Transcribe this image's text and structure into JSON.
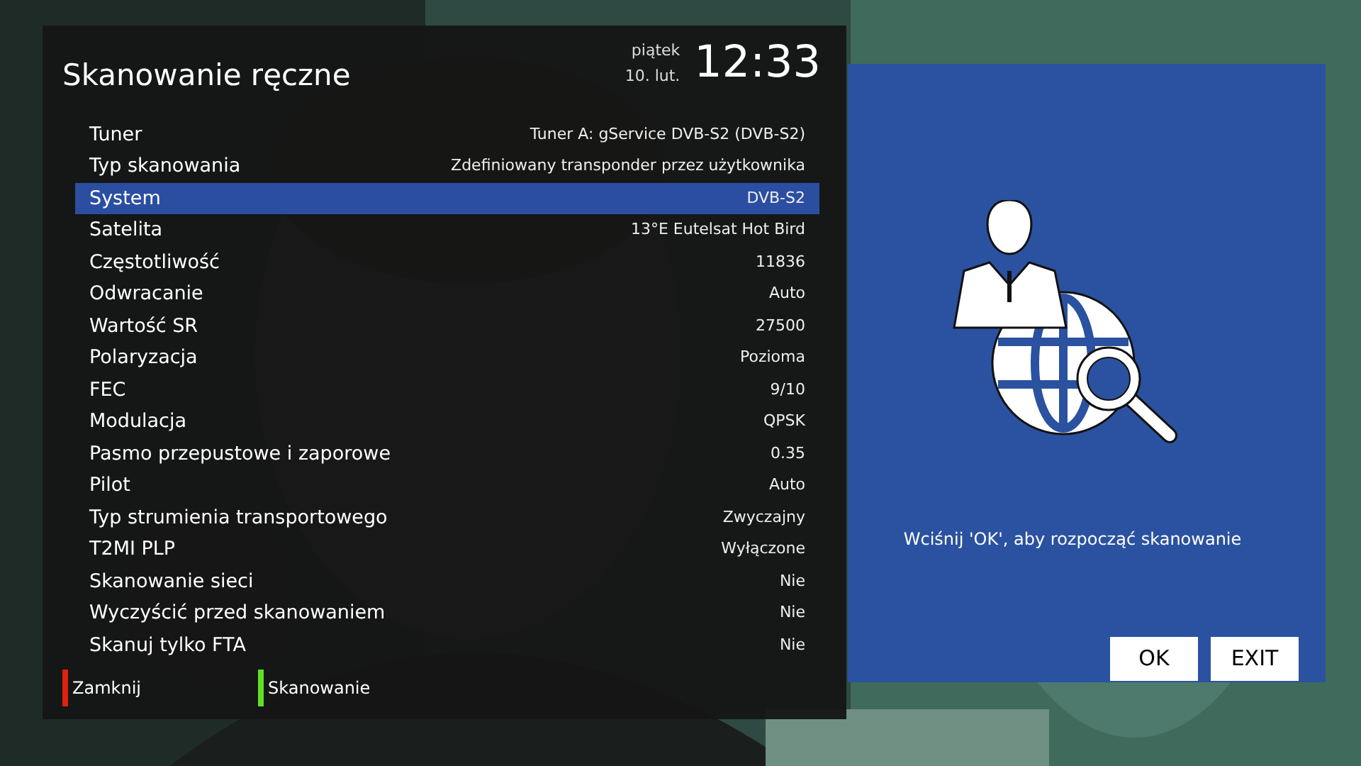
{
  "title": "Skanowanie ręczne",
  "clock": {
    "day": "piątek",
    "date": "10. lut.",
    "time": "12:33"
  },
  "settings": [
    {
      "label": "Tuner",
      "value": "Tuner A: gService DVB-S2 (DVB-S2)",
      "selected": false
    },
    {
      "label": "Typ skanowania",
      "value": "Zdefiniowany transponder przez użytkownika",
      "selected": false
    },
    {
      "label": "System",
      "value": "DVB-S2",
      "selected": true
    },
    {
      "label": "Satelita",
      "value": "13°E Eutelsat Hot Bird",
      "selected": false
    },
    {
      "label": "Częstotliwość",
      "value": "11836",
      "selected": false
    },
    {
      "label": "Odwracanie",
      "value": "Auto",
      "selected": false
    },
    {
      "label": "Wartość SR",
      "value": "27500",
      "selected": false
    },
    {
      "label": "Polaryzacja",
      "value": "Pozioma",
      "selected": false
    },
    {
      "label": "FEC",
      "value": "9/10",
      "selected": false
    },
    {
      "label": "Modulacja",
      "value": "QPSK",
      "selected": false
    },
    {
      "label": "Pasmo przepustowe i zaporowe",
      "value": "0.35",
      "selected": false
    },
    {
      "label": "Pilot",
      "value": "Auto",
      "selected": false
    },
    {
      "label": "Typ strumienia transportowego",
      "value": "Zwyczajny",
      "selected": false
    },
    {
      "label": "T2MI PLP",
      "value": "Wyłączone",
      "selected": false
    },
    {
      "label": "Skanowanie sieci",
      "value": "Nie",
      "selected": false
    },
    {
      "label": "Wyczyścić przed skanowaniem",
      "value": "Nie",
      "selected": false
    },
    {
      "label": "Skanuj tylko FTA",
      "value": "Nie",
      "selected": false
    }
  ],
  "color_keys": [
    {
      "label": "Zamknij",
      "color": "#e02010"
    },
    {
      "label": "Skanowanie",
      "color": "#60e020"
    }
  ],
  "info_panel": {
    "message": "Wciśnij 'OK', aby rozpocząć skanowanie",
    "buttons": [
      "OK",
      "EXIT"
    ]
  }
}
